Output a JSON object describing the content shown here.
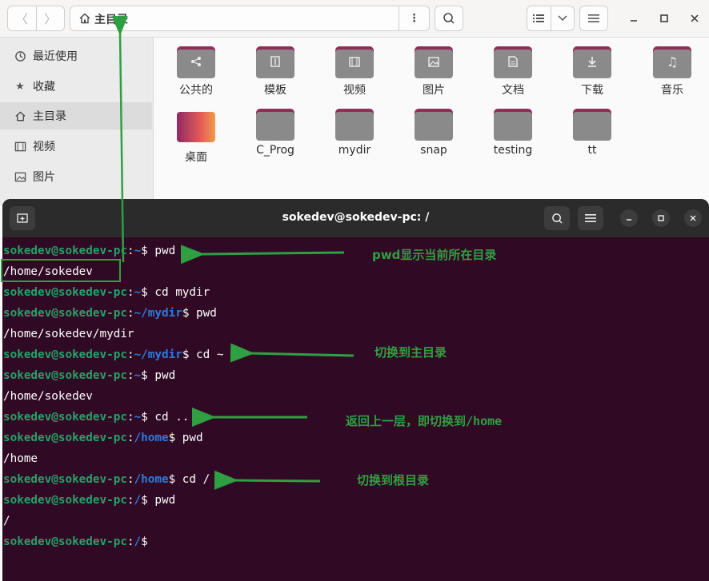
{
  "file_manager": {
    "path": "主目录",
    "sidebar": [
      {
        "label": "最近使用",
        "icon": "clock-icon"
      },
      {
        "label": "收藏",
        "icon": "star-icon"
      },
      {
        "label": "主目录",
        "icon": "home-icon",
        "active": true
      },
      {
        "label": "视频",
        "icon": "film-icon"
      },
      {
        "label": "图片",
        "icon": "image-icon"
      }
    ],
    "folders": [
      {
        "label": "公共的",
        "emblem": "share-icon"
      },
      {
        "label": "模板",
        "emblem": "template-icon"
      },
      {
        "label": "视频",
        "emblem": "film-icon"
      },
      {
        "label": "图片",
        "emblem": "image-icon"
      },
      {
        "label": "文档",
        "emblem": "document-icon"
      },
      {
        "label": "下载",
        "emblem": "download-icon"
      },
      {
        "label": "音乐",
        "emblem": "music-icon"
      },
      {
        "label": "桌面",
        "emblem": "desktop-icon"
      },
      {
        "label": "C_Prog",
        "emblem": ""
      },
      {
        "label": "mydir",
        "emblem": ""
      },
      {
        "label": "snap",
        "emblem": ""
      },
      {
        "label": "testing",
        "emblem": ""
      },
      {
        "label": "tt",
        "emblem": ""
      }
    ],
    "colors": {
      "folder_tab": "#8f2e56",
      "folder_face": "#8a8a8a"
    }
  },
  "terminal": {
    "title": "sokedev@sokedev-pc: /",
    "lines": [
      {
        "user": "sokedev@sokedev-pc",
        "path": "~",
        "cmd": " pwd"
      },
      {
        "output": "/home/sokedev"
      },
      {
        "user": "sokedev@sokedev-pc",
        "path": "~",
        "cmd": " cd mydir"
      },
      {
        "user": "sokedev@sokedev-pc",
        "path": "~/mydir",
        "cmd": " pwd"
      },
      {
        "output": "/home/sokedev/mydir"
      },
      {
        "user": "sokedev@sokedev-pc",
        "path": "~/mydir",
        "cmd": " cd ~"
      },
      {
        "user": "sokedev@sokedev-pc",
        "path": "~",
        "cmd": " pwd"
      },
      {
        "output": "/home/sokedev"
      },
      {
        "user": "sokedev@sokedev-pc",
        "path": "~",
        "cmd": " cd .."
      },
      {
        "user": "sokedev@sokedev-pc",
        "path": "/home",
        "cmd": " pwd"
      },
      {
        "output": "/home"
      },
      {
        "user": "sokedev@sokedev-pc",
        "path": "/home",
        "cmd": " cd /"
      },
      {
        "user": "sokedev@sokedev-pc",
        "path": "/",
        "cmd": " pwd"
      },
      {
        "output": "/"
      },
      {
        "user": "sokedev@sokedev-pc",
        "path": "/",
        "cmd": ""
      }
    ],
    "colors": {
      "background": "#300a24",
      "user": "#26a269",
      "path": "#2a7bde"
    }
  },
  "annotations": [
    {
      "text": "pwd显示当前所在目录"
    },
    {
      "text": "切换到主目录"
    },
    {
      "text_cn": "返回上一层，即切换到",
      "text_en": "/home"
    },
    {
      "text": "切换到根目录"
    }
  ],
  "annotation_color": "#2ea043"
}
